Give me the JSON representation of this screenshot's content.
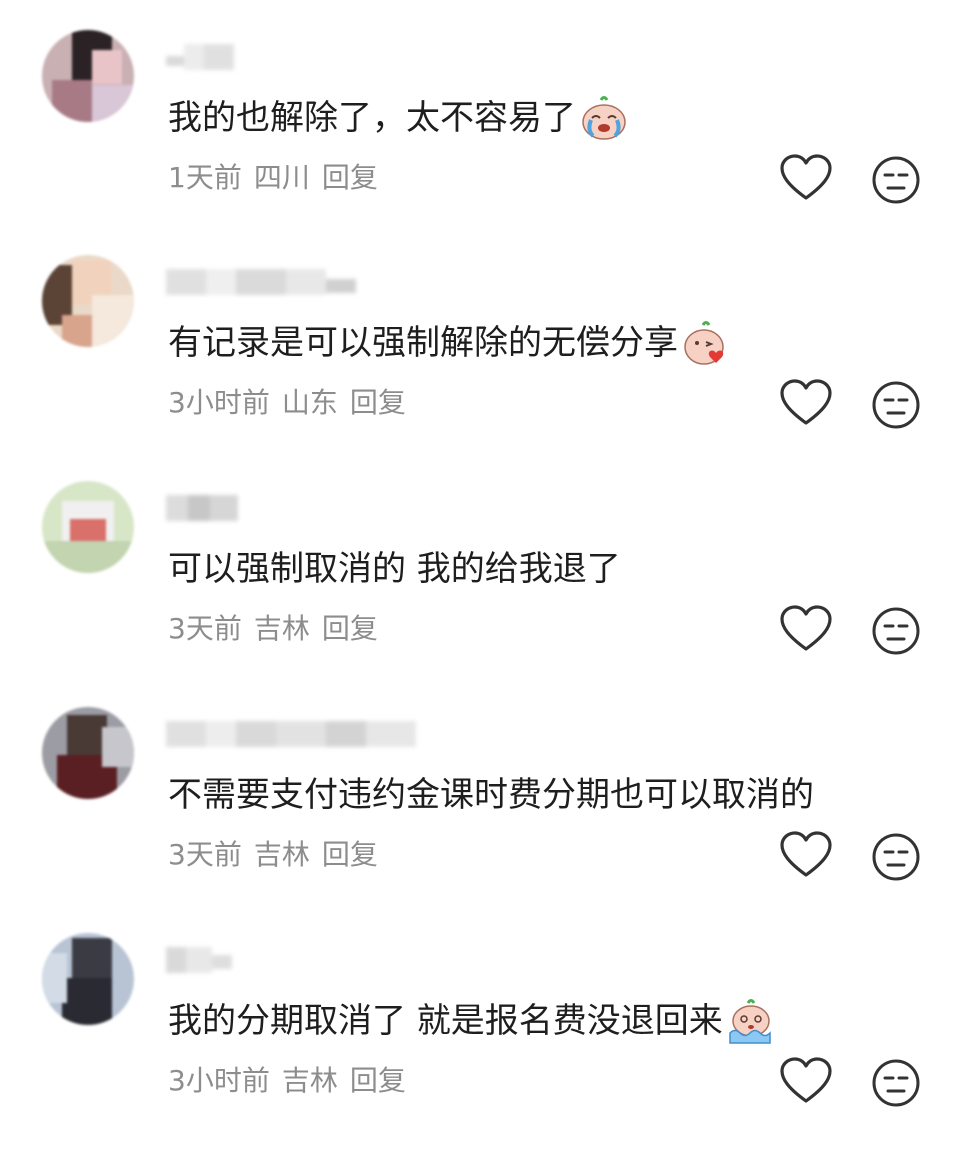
{
  "comments": [
    {
      "text": "我的也解除了，太不容易了",
      "emoji": "crying-face-emoji",
      "time": "1天前",
      "location": "四川",
      "reply": "回复"
    },
    {
      "text": "有记录是可以强制解除的无偿分享",
      "emoji": "blowing-kiss-emoji",
      "time": "3小时前",
      "location": "山东",
      "reply": "回复"
    },
    {
      "text": "可以强制取消的 我的给我退了",
      "emoji": "",
      "time": "3天前",
      "location": "吉林",
      "reply": "回复"
    },
    {
      "text": "不需要支付违约金课时费分期也可以取消的",
      "emoji": "",
      "time": "3天前",
      "location": "吉林",
      "reply": "回复"
    },
    {
      "text": "我的分期取消了 就是报名费没退回来",
      "emoji": "crying-in-water-emoji",
      "time": "3小时前",
      "location": "吉林",
      "reply": "回复"
    }
  ],
  "icons": {
    "like": "heart-outline-icon",
    "dislike": "neutral-face-icon"
  },
  "colors": {
    "text": "#1e1e1e",
    "meta": "#8d8d8d",
    "icon": "#333333"
  }
}
